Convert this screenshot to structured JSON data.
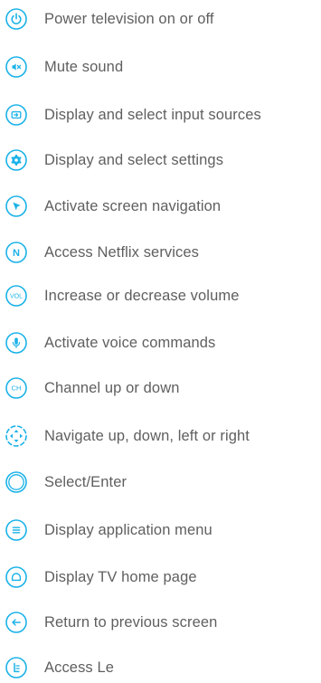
{
  "accent_color": "#1ab2e8",
  "text_color": "#5f5f5f",
  "legend": {
    "items": [
      {
        "icon": "power-icon",
        "label": "Power television on or off"
      },
      {
        "icon": "mute-icon",
        "label": "Mute sound"
      },
      {
        "icon": "input-icon",
        "label": "Display and select input sources"
      },
      {
        "icon": "settings-icon",
        "label": "Display and select settings"
      },
      {
        "icon": "pointer-icon",
        "label": "Activate screen navigation"
      },
      {
        "icon": "netflix-icon",
        "label": "Access Netflix services",
        "glyph": "N"
      },
      {
        "icon": "volume-icon",
        "label": "Increase or decrease volume",
        "glyph": "VOL"
      },
      {
        "icon": "microphone-icon",
        "label": "Activate voice commands"
      },
      {
        "icon": "channel-icon",
        "label": "Channel up or down",
        "glyph": "CH"
      },
      {
        "icon": "navigation-arrows-icon",
        "label": "Navigate up, down, left or right"
      },
      {
        "icon": "select-enter-icon",
        "label": "Select/Enter"
      },
      {
        "icon": "menu-icon",
        "label": "Display application menu"
      },
      {
        "icon": "home-icon",
        "label": "Display TV home page"
      },
      {
        "icon": "back-arrow-icon",
        "label": "Return to previous screen"
      },
      {
        "icon": "le-icon",
        "label": "Access Le"
      }
    ]
  }
}
